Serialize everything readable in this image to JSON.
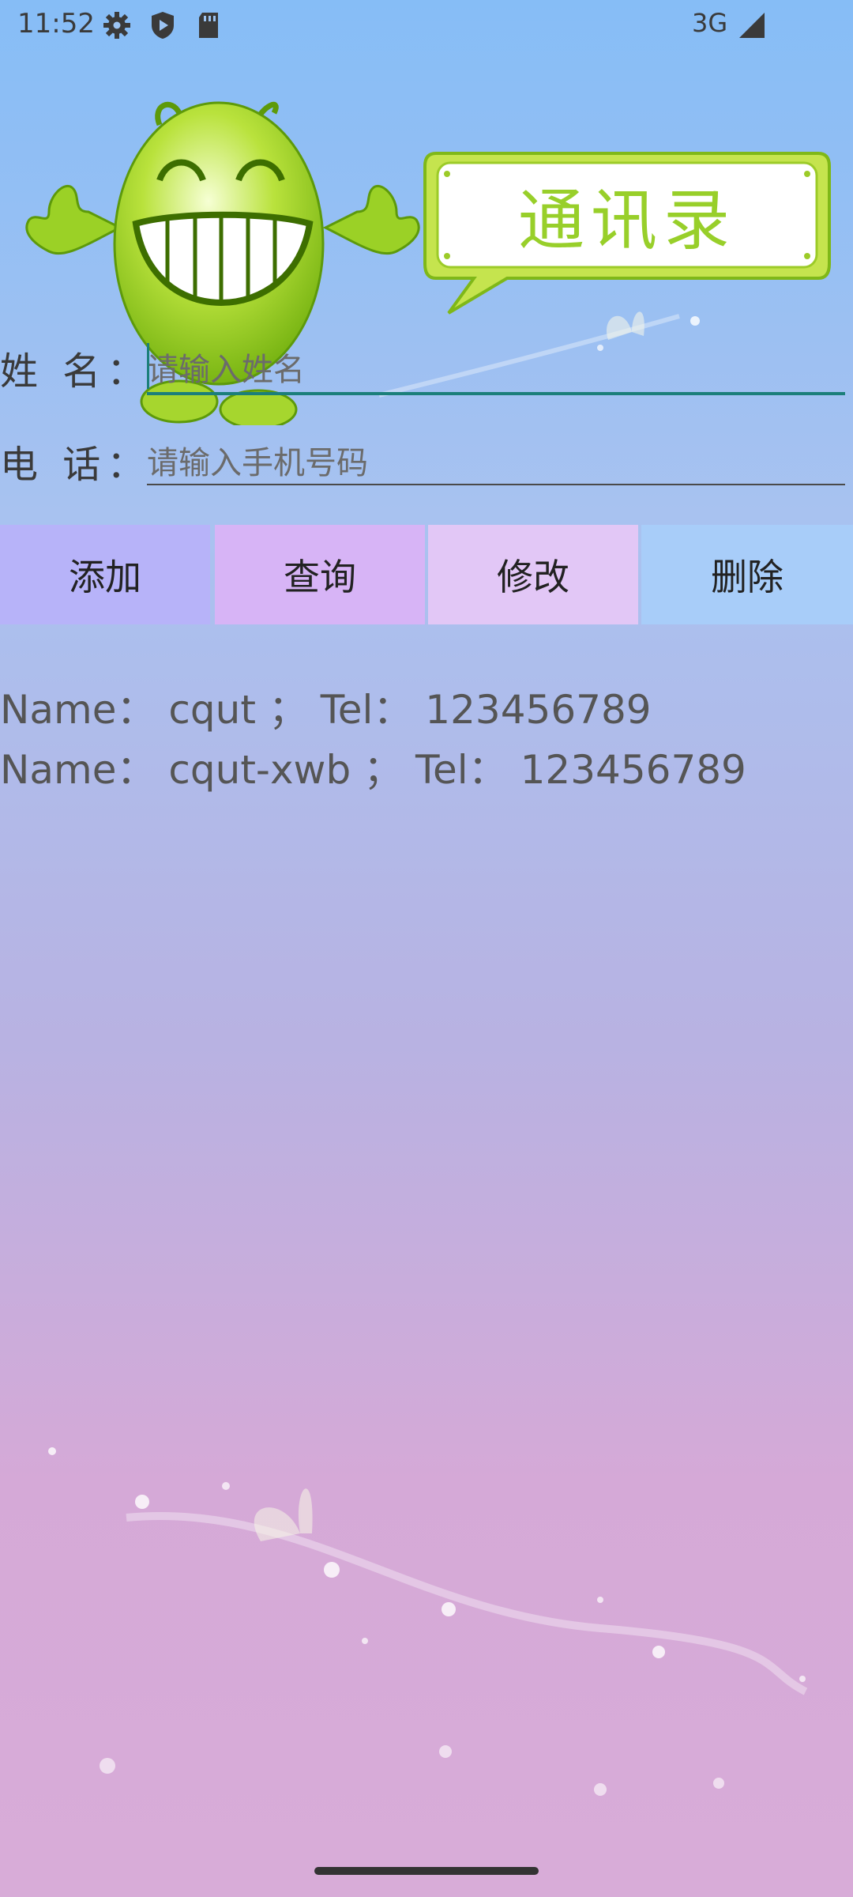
{
  "status_bar": {
    "time": "11:52",
    "icons": [
      "settings-gear-icon",
      "shield-play-icon",
      "sd-card-icon",
      "signal-icon"
    ],
    "network": "3G"
  },
  "header": {
    "bubble_text": "通讯录",
    "mascot": "green-smiley-mascot"
  },
  "form": {
    "name_label": "姓 名：",
    "name_placeholder": "请输入姓名",
    "name_value": "",
    "phone_label": "电 话：",
    "phone_placeholder": "请输入手机号码",
    "phone_value": ""
  },
  "buttons": {
    "add": "添加",
    "query": "查询",
    "edit": "修改",
    "delete": "删除"
  },
  "results": [
    "Name： cqut ； Tel： 123456789",
    "Name： cqut-xwb ； Tel： 123456789"
  ],
  "colors": {
    "accent": "#1b7f7a",
    "btn_add": "#b7b3f9",
    "btn_query": "#d7b4f6",
    "btn_edit": "#e2c7f6",
    "btn_delete": "#a8cdf9"
  }
}
